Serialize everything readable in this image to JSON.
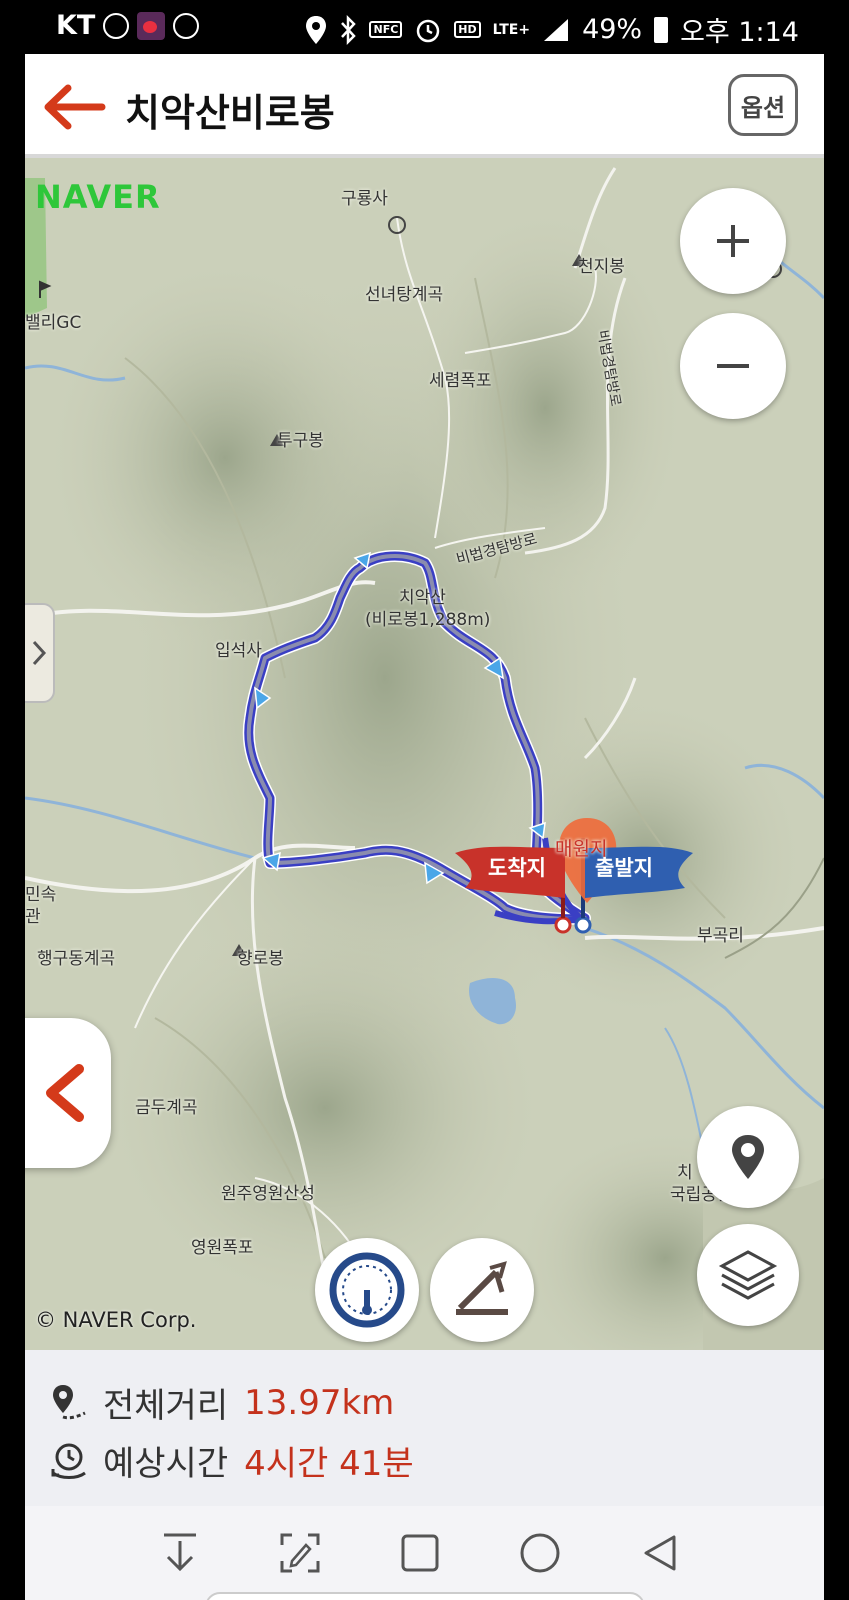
{
  "status_bar": {
    "carrier": "KT",
    "network": "LTE+",
    "battery": "49%",
    "time": "오후 1:14",
    "icons": [
      "walk-icon",
      "cherry-app-icon",
      "walk-icon",
      "location-icon",
      "bluetooth-icon",
      "nfc-icon",
      "alarm-icon",
      "hd-icon",
      "signal-icon",
      "battery-icon"
    ]
  },
  "header": {
    "title": "치악산비로봉",
    "options_label": "옵션"
  },
  "map": {
    "brand": "NAVER",
    "copyright": "© NAVER Corp.",
    "labels": {
      "gurongsa": "구룡사",
      "seonnyeotang": "선녀탕계곡",
      "cheonjibong": "천지봉",
      "seryeom": "세렴폭포",
      "tugubong": "투구봉",
      "peak_name": "치악산",
      "peak_sub": "(비로봉1,288m)",
      "ipseoksa": "입석사",
      "valley_gc": "밸리GC",
      "hyanggudong": "행구동계곡",
      "hyangrobong": "향로봉",
      "minsok": "민속",
      "gwan": "관",
      "geumdu": "금두계곡",
      "youngwon_fortress": "원주영원산성",
      "youngwon_falls": "영원폭포",
      "bugok": "부곡리",
      "park_line1": "치",
      "park_line2": "국립공원",
      "trail_top": "비법경탐방로",
      "trail_right": "비법경탐방로",
      "parking": "매원지"
    },
    "flags": {
      "arrival": "도착지",
      "departure": "출발지",
      "arrival_color": "#c8322a",
      "departure_color": "#2f5fb0"
    },
    "route_color": "#3a3fc4"
  },
  "info": {
    "distance_label": "전체거리",
    "distance_value": "13.97km",
    "time_label": "예상시간",
    "time_value": "4시간 41분",
    "accent_color": "#c4321c"
  },
  "navbar": {
    "icons": [
      "download-icon",
      "edit-capture-icon",
      "recents-icon",
      "home-icon",
      "back-triangle-icon"
    ]
  }
}
